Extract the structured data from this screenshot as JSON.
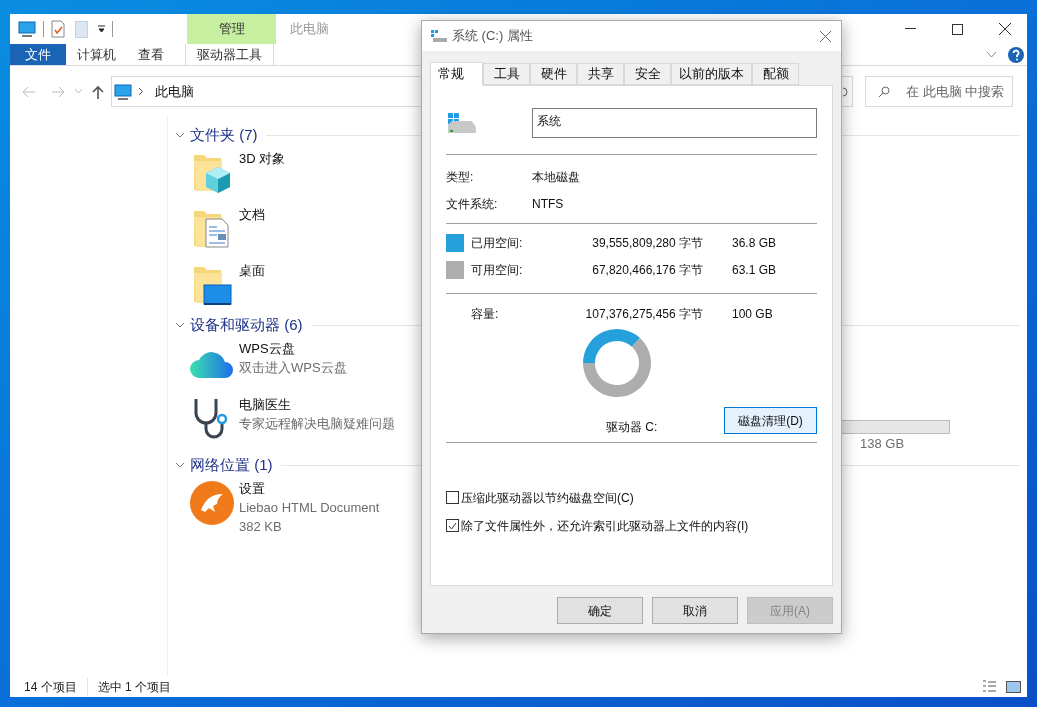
{
  "explorer": {
    "title": "此电脑",
    "context_tab": "管理",
    "ribbon_tabs": [
      {
        "label": "文件",
        "kind": "file",
        "selected": false
      },
      {
        "label": "计算机",
        "kind": "tab",
        "selected": false
      },
      {
        "label": "查看",
        "kind": "tab",
        "selected": false
      },
      {
        "label": "驱动器工具",
        "kind": "context",
        "selected": false
      }
    ],
    "address": {
      "path": "此电脑"
    },
    "search": {
      "placeholder": "在 此电脑 中搜索"
    },
    "groups": [
      {
        "title": "文件夹 (7)",
        "expanded": true,
        "items": [
          {
            "name": "3D 对象",
            "kind": "objects"
          },
          {
            "name": "文档",
            "kind": "documents"
          },
          {
            "name": "桌面",
            "kind": "desktop"
          }
        ]
      },
      {
        "title": "设备和驱动器 (6)",
        "expanded": true,
        "items": [
          {
            "name": "WPS云盘",
            "kind": "cloud",
            "details": [
              "双击进入WPS云盘"
            ]
          },
          {
            "name": "电脑医生",
            "kind": "doctor",
            "details": [
              "专家远程解决电脑疑难问题"
            ]
          }
        ],
        "hidden_drive": {
          "size": "138 GB"
        }
      },
      {
        "title": "网络位置 (1)",
        "expanded": true,
        "items": [
          {
            "name": "设置",
            "kind": "browser",
            "details": [
              "Liebao HTML Document",
              "382 KB"
            ]
          }
        ]
      }
    ],
    "status_bar": [
      "14 个项目",
      "选中 1 个项目"
    ]
  },
  "dialog": {
    "title": "系统 (C:) 属性",
    "tabs": [
      {
        "label": "常规",
        "selected": true
      },
      {
        "label": "工具",
        "selected": false
      },
      {
        "label": "硬件",
        "selected": false
      },
      {
        "label": "共享",
        "selected": false
      },
      {
        "label": "安全",
        "selected": false
      },
      {
        "label": "以前的版本",
        "selected": false
      },
      {
        "label": "配额",
        "selected": false
      }
    ],
    "name_field": {
      "value": "系统"
    },
    "info": [
      {
        "label": "类型:",
        "value": "本地磁盘"
      },
      {
        "label": "文件系统:",
        "value": "NTFS"
      }
    ],
    "usage": [
      {
        "label": "已用空间:",
        "bytes": "39,555,809,280 字节",
        "size": "36.8 GB",
        "color": "#26a0da"
      },
      {
        "label": "可用空间:",
        "bytes": "67,820,466,176 字节",
        "size": "63.1 GB",
        "color": "#adadad"
      }
    ],
    "capacity": {
      "label": "容量:",
      "bytes": "107,376,275,456 字节",
      "size": "100 GB"
    },
    "chart_data": {
      "type": "donut",
      "values": [
        36.8,
        63.1
      ],
      "colors": [
        "#26a0da",
        "#adadad"
      ]
    },
    "drive_label": "驱动器 C:",
    "cleanup_button": "磁盘清理(D)",
    "options": [
      {
        "label": "压缩此驱动器以节约磁盘空间(C)",
        "checked": false
      },
      {
        "label": "除了文件属性外，还允许索引此驱动器上文件的内容(I)",
        "checked": true
      }
    ],
    "buttons": [
      {
        "label": "确定",
        "disabled": false
      },
      {
        "label": "取消",
        "disabled": false
      },
      {
        "label": "应用(A)",
        "disabled": true
      }
    ]
  }
}
